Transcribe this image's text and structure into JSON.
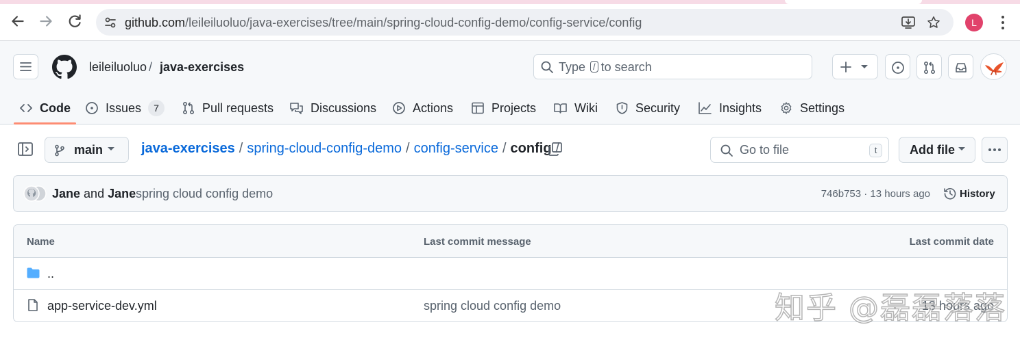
{
  "browser": {
    "url_host": "github.com",
    "url_path": "/leileiluoluo/java-exercises/tree/main/spring-cloud-config-demo/config-service/config",
    "profile_initial": "L"
  },
  "header": {
    "owner": "leileiluoluo",
    "separator": "/",
    "repo": "java-exercises",
    "search_prefix": "Type",
    "search_key": "/",
    "search_suffix": "to search"
  },
  "tabs": [
    {
      "label": "Code"
    },
    {
      "label": "Issues",
      "count": "7"
    },
    {
      "label": "Pull requests"
    },
    {
      "label": "Discussions"
    },
    {
      "label": "Actions"
    },
    {
      "label": "Projects"
    },
    {
      "label": "Wiki"
    },
    {
      "label": "Security"
    },
    {
      "label": "Insights"
    },
    {
      "label": "Settings"
    }
  ],
  "filenav": {
    "branch": "main",
    "breadcrumbs": [
      "java-exercises",
      "spring-cloud-config-demo",
      "config-service"
    ],
    "current": "config",
    "separator": "/",
    "goto_placeholder": "Go to file",
    "goto_key": "t",
    "add_file": "Add file"
  },
  "commit": {
    "author1": "Jane",
    "conj": "and",
    "author2": "Jane",
    "message": "spring cloud config demo",
    "sha_time": "746b753 · 13 hours ago",
    "history": "History"
  },
  "table": {
    "headers": {
      "name": "Name",
      "message": "Last commit message",
      "date": "Last commit date"
    },
    "rows": [
      {
        "name": "..",
        "message": "",
        "date": ""
      },
      {
        "name": "app-service-dev.yml",
        "message": "spring cloud config demo",
        "date": "13 hours ago"
      }
    ]
  },
  "watermark": "知乎 @磊磊落落",
  "colors": {
    "link": "#0969da",
    "tab_underline": "#fd8c73",
    "folder": "#54aeff",
    "profile": "#e1426b"
  }
}
